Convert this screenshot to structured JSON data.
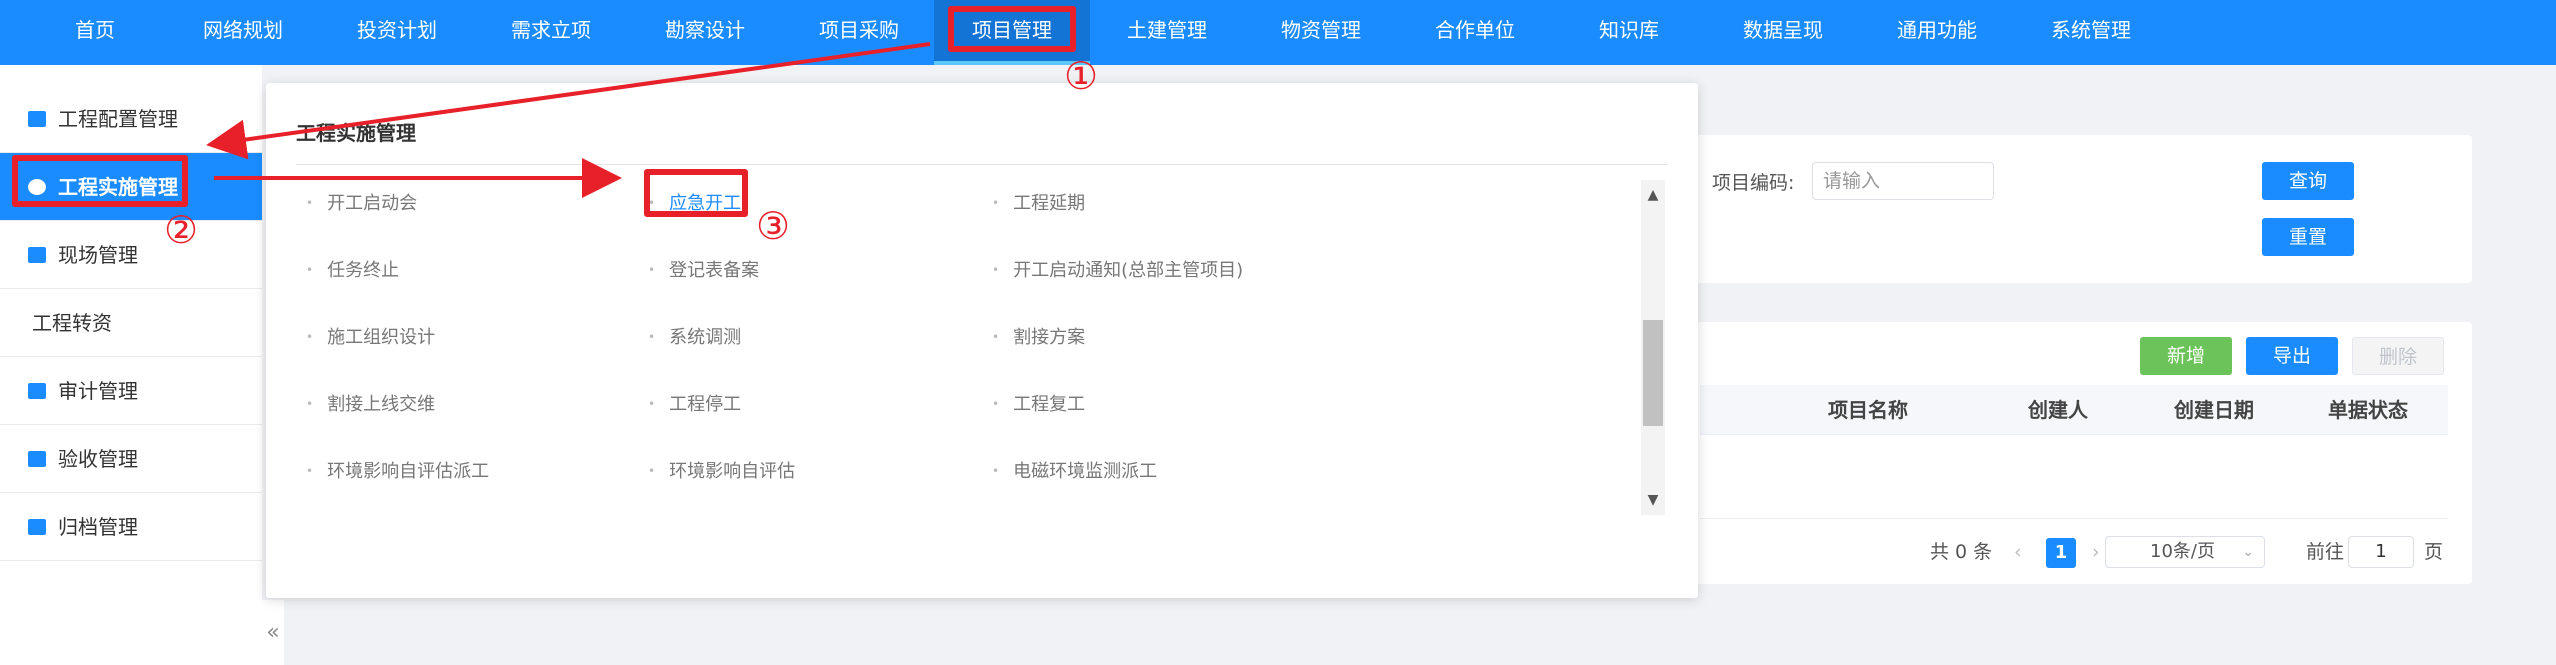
{
  "topnav": {
    "items": [
      "首页",
      "网络规划",
      "投资计划",
      "需求立项",
      "勘察设计",
      "项目采购",
      "项目管理",
      "土建管理",
      "物资管理",
      "合作单位",
      "知识库",
      "数据呈现",
      "通用功能",
      "系统管理"
    ],
    "active_index": 6
  },
  "sidebar": {
    "items": [
      "工程配置管理",
      "工程实施管理",
      "现场管理",
      "工程转资",
      "审计管理",
      "验收管理",
      "归档管理"
    ],
    "active_index": 1,
    "collapse_icon": "«"
  },
  "dropdown": {
    "title": "工程实施管理",
    "items": [
      "开工启动会",
      "应急开工",
      "工程延期",
      "任务终止",
      "登记表备案",
      "开工启动通知(总部主管项目)",
      "施工组织设计",
      "系统调测",
      "割接方案",
      "割接上线交维",
      "工程停工",
      "工程复工",
      "环境影响自评估派工",
      "环境影响自评估",
      "电磁环境监测派工"
    ],
    "highlighted": "应急开工"
  },
  "search": {
    "label": "项目编码:",
    "placeholder": "请输入",
    "query_button": "查询",
    "reset_button": "重置"
  },
  "toolbar": {
    "add_button": "新增",
    "export_button": "导出",
    "delete_button": "删除"
  },
  "table": {
    "columns": [
      "项目名称",
      "创建人",
      "创建日期",
      "单据状态"
    ]
  },
  "pagination": {
    "total_text": "共 0 条",
    "prev": "‹",
    "current_page": "1",
    "next": "›",
    "page_size": "10条/页",
    "goto_label": "前往",
    "goto_value": "1",
    "page_suffix": "页"
  },
  "annotations": {
    "step1": "①",
    "step2": "②",
    "step3": "③"
  },
  "colors": {
    "nav_bg": "#1a8cff",
    "accent": "#1a8cff",
    "annotation": "#e8202a",
    "add_button": "#6cc35a"
  }
}
